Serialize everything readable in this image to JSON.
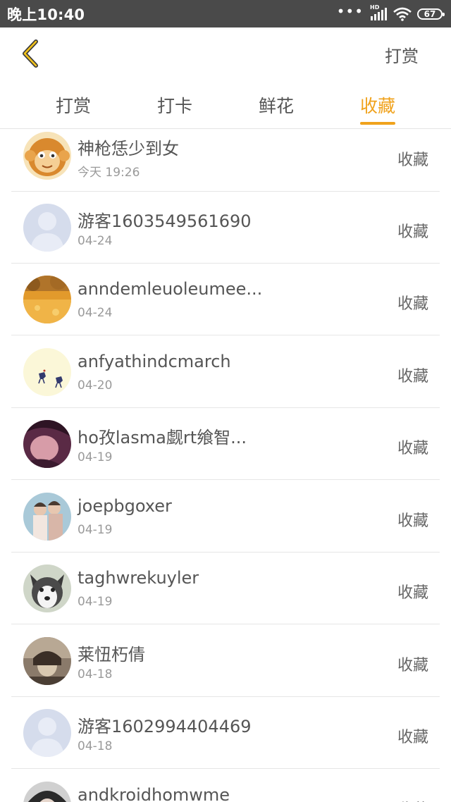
{
  "status_bar": {
    "time": "晚上10:40",
    "dots": "•••",
    "network": "HD",
    "battery": "67"
  },
  "header": {
    "back_icon": "chevron-left-icon",
    "action_label": "打赏",
    "accent_color": "#f0a21c"
  },
  "tabs": [
    {
      "label": "打赏",
      "active": false
    },
    {
      "label": "打卡",
      "active": false
    },
    {
      "label": "鲜花",
      "active": false
    },
    {
      "label": "收藏",
      "active": true
    }
  ],
  "list": [
    {
      "name": "神枪恁少到女",
      "date": "今天 19:26",
      "action": "收藏",
      "avatar": "monkey-avatar"
    },
    {
      "name": "游客1603549561690",
      "date": "04-24",
      "action": "收藏",
      "avatar": "default-avatar"
    },
    {
      "name": "anndemleuoleumee...",
      "date": "04-24",
      "action": "收藏",
      "avatar": "autumn-field-avatar"
    },
    {
      "name": "anfyathindcmarch",
      "date": "04-20",
      "action": "收藏",
      "avatar": "deer-avatar"
    },
    {
      "name": "ho孜lasma觑rt飨智...",
      "date": "04-19",
      "action": "收藏",
      "avatar": "portrait-avatar"
    },
    {
      "name": "joepbgoxer",
      "date": "04-19",
      "action": "收藏",
      "avatar": "couple-avatar"
    },
    {
      "name": "taghwrekuyler",
      "date": "04-19",
      "action": "收藏",
      "avatar": "husky-avatar"
    },
    {
      "name": "莱忸朽倩",
      "date": "04-18",
      "action": "收藏",
      "avatar": "sepia-portrait-avatar"
    },
    {
      "name": "游客1602994404469",
      "date": "04-18",
      "action": "收藏",
      "avatar": "default-avatar"
    },
    {
      "name": "andkroidhomwme",
      "date": "",
      "action": "收藏",
      "avatar": "dark-portrait-avatar"
    }
  ]
}
